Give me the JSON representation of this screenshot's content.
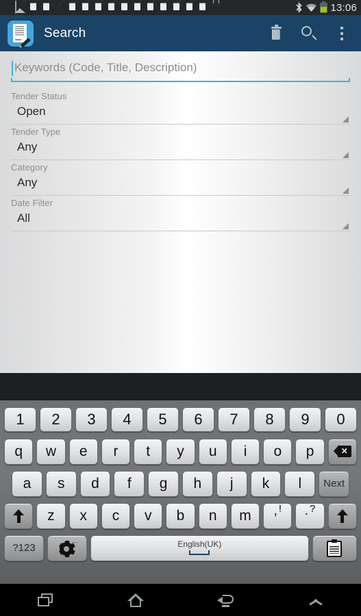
{
  "status_bar": {
    "clock": "13:06",
    "left_icons": [
      {
        "name": "keyboard-icon",
        "type": "keyboard"
      },
      {
        "name": "picture-icon",
        "type": "picture"
      },
      {
        "name": "document-notification-icon",
        "type": "doc"
      },
      {
        "name": "document-notification-icon",
        "type": "doc"
      },
      {
        "name": "warning-icon",
        "type": "warn"
      },
      {
        "name": "document-notification-icon",
        "type": "doc"
      },
      {
        "name": "document-notification-icon",
        "type": "doc"
      },
      {
        "name": "document-notification-icon",
        "type": "doc"
      },
      {
        "name": "document-notification-icon",
        "type": "doc"
      },
      {
        "name": "document-notification-icon",
        "type": "doc"
      },
      {
        "name": "document-notification-icon",
        "type": "doc"
      },
      {
        "name": "document-notification-icon",
        "type": "doc"
      },
      {
        "name": "document-notification-icon",
        "type": "doc"
      },
      {
        "name": "document-notification-icon",
        "type": "doc"
      },
      {
        "name": "document-notification-icon",
        "type": "doc"
      },
      {
        "name": "document-notification-icon",
        "type": "doc"
      },
      {
        "name": "store-icon",
        "type": "store"
      }
    ],
    "right_icons": [
      "bluetooth-icon",
      "wifi-icon",
      "battery-icon"
    ],
    "battery_color": "#99cc00"
  },
  "action_bar": {
    "title": "Search",
    "app_icon": "document-edit-icon",
    "background": "#1b4365",
    "actions": [
      {
        "name": "delete-button",
        "icon": "trash-icon"
      },
      {
        "name": "search-button",
        "icon": "search-icon"
      },
      {
        "name": "overflow-menu-button",
        "icon": "overflow-menu-icon"
      }
    ]
  },
  "form": {
    "keywords": {
      "placeholder": "Keywords (Code, Title, Description)",
      "value": "",
      "accent": "#33b5e5"
    },
    "fields": [
      {
        "label": "Tender Status",
        "value": "Open"
      },
      {
        "label": "Tender Type",
        "value": "Any"
      },
      {
        "label": "Category",
        "value": "Any"
      },
      {
        "label": "Date Filter",
        "value": "All"
      }
    ]
  },
  "keyboard": {
    "language": "English(UK)",
    "rows": {
      "numbers": [
        "1",
        "2",
        "3",
        "4",
        "5",
        "6",
        "7",
        "8",
        "9",
        "0"
      ],
      "top": [
        "q",
        "w",
        "e",
        "r",
        "t",
        "y",
        "u",
        "i",
        "o",
        "p"
      ],
      "home": [
        "a",
        "s",
        "d",
        "f",
        "g",
        "h",
        "j",
        "k",
        "l"
      ],
      "bottom": [
        "z",
        "x",
        "c",
        "v",
        "b",
        "n",
        "m"
      ]
    },
    "backspace": "backspace-icon",
    "enter_label": "Next",
    "shift_left": "shift-icon",
    "shift_right": "shift-icon",
    "punct_comma": {
      "main": ",",
      "alt": "!"
    },
    "punct_period": {
      "main": ".",
      "alt": "?"
    },
    "symbols_label": "?123",
    "settings_icon": "gear-icon",
    "clipboard_icon": "clipboard-icon"
  },
  "nav_bar": {
    "buttons": [
      {
        "name": "recents-button",
        "icon": "recents-icon"
      },
      {
        "name": "home-button",
        "icon": "home-icon"
      },
      {
        "name": "back-button",
        "icon": "back-icon"
      },
      {
        "name": "hide-keyboard-button",
        "icon": "chevron-up-icon"
      }
    ]
  }
}
